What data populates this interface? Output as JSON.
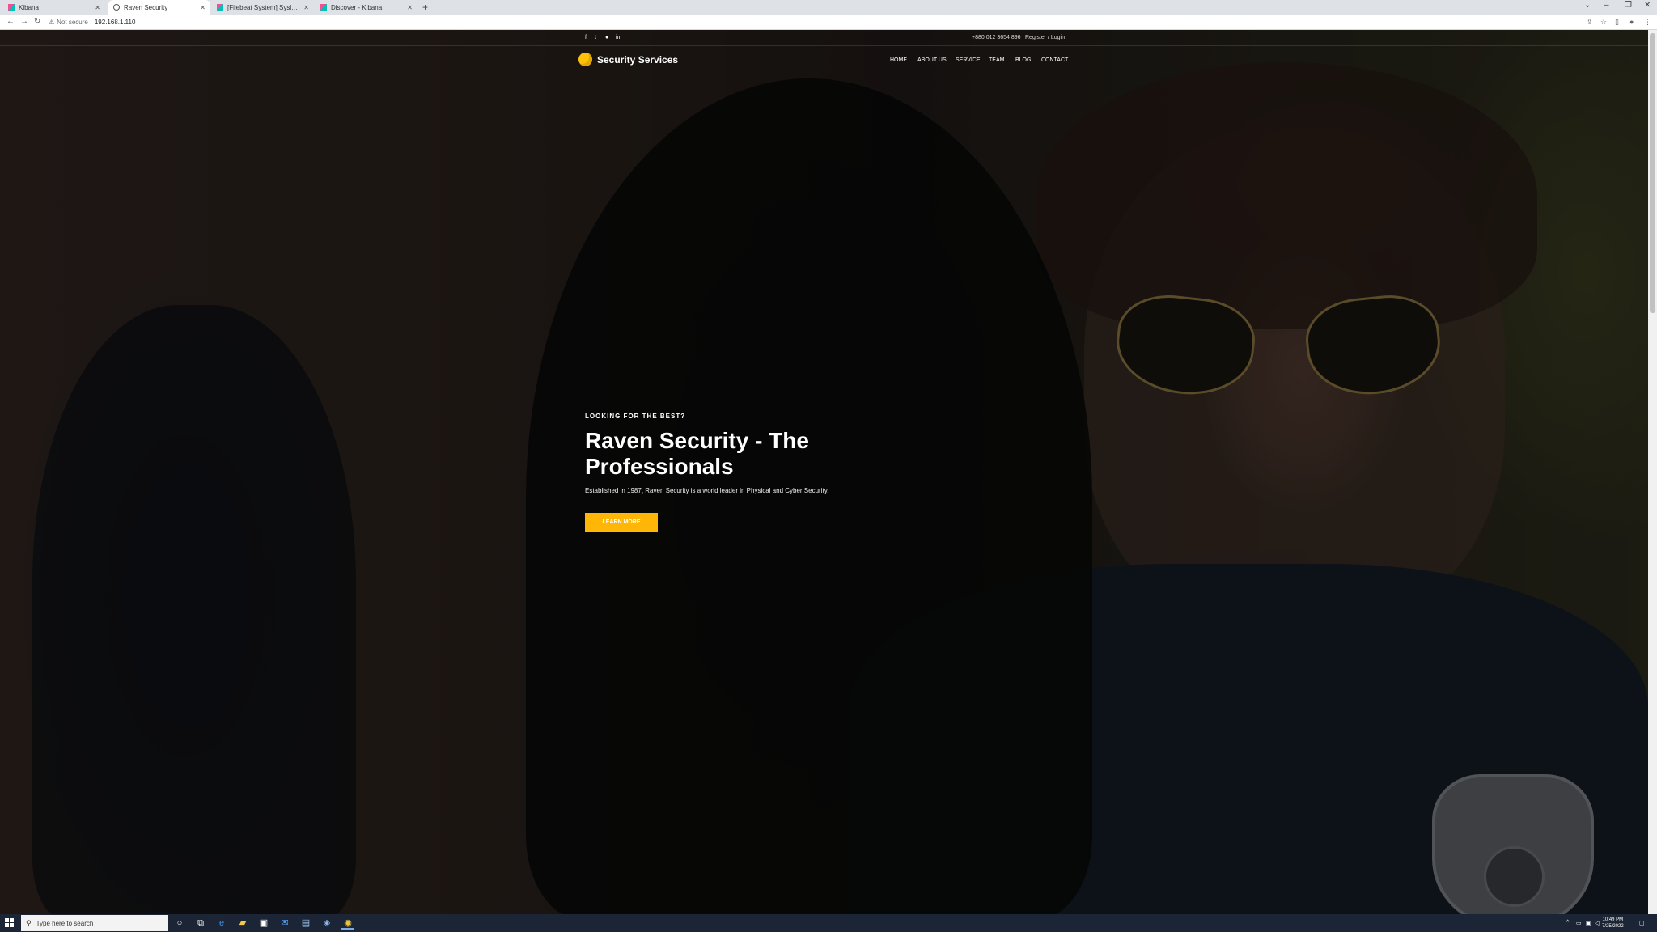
{
  "browser": {
    "tabs": [
      {
        "label": "Kibana",
        "icon": "kibana-icon",
        "active": false
      },
      {
        "label": "Raven Security",
        "icon": "globe-icon",
        "active": true
      },
      {
        "label": "[Filebeat System] Syslog dashboard",
        "icon": "kibana-icon",
        "active": false
      },
      {
        "label": "Discover - Kibana",
        "icon": "kibana-icon",
        "active": false
      }
    ],
    "security_label": "Not secure",
    "url": "192.168.1.110"
  },
  "site": {
    "phone": "+880 012 3654 896",
    "register_login": "Register / Login",
    "brand_name": "Security Services",
    "nav": [
      "HOME",
      "ABOUT US",
      "SERVICE",
      "TEAM",
      "BLOG",
      "CONTACT"
    ],
    "social_icons": [
      "facebook-icon",
      "twitter-icon",
      "pinterest-icon",
      "linkedin-icon"
    ],
    "accent_color": "#ffb606"
  },
  "hero": {
    "eyebrow": "LOOKING FOR THE BEST?",
    "headline": "Raven Security - The Professionals",
    "lede": "Established in 1987, Raven Security is a world leader in Physical and Cyber Security.",
    "cta_label": "LEARN MORE"
  },
  "taskbar": {
    "search_placeholder": "Type here to search",
    "time": "10:49 PM",
    "date": "7/25/2022"
  }
}
